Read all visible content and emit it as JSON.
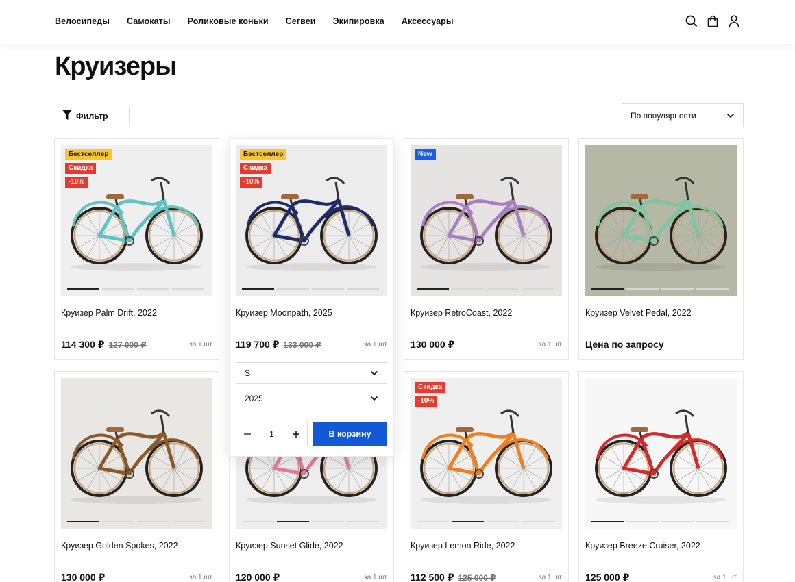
{
  "nav": [
    "Велосипеды",
    "Самокаты",
    "Роликовые коньки",
    "Сегвеи",
    "Экипировка",
    "Аксессуары"
  ],
  "page_title": "Круизеры",
  "toolbar": {
    "filter_label": "Фильтр",
    "sort_value": "По популярности"
  },
  "colors": {
    "accent": "#1358d6",
    "bestseller": "#f7c630",
    "sale": "#e9392f",
    "new": "#1a5fe0"
  },
  "products": [
    {
      "name": "Круизер Palm Drift, 2022",
      "price": "114 300 ₽",
      "old_price": "127 000 ₽",
      "per": "за 1 шт",
      "badges": [
        "Бестселлер",
        "Скидка",
        "-10%"
      ],
      "frame_color": "#5fc4c0"
    },
    {
      "name": "Круизер Moonpath, 2025",
      "price": "119 700 ₽",
      "old_price": "133 000 ₽",
      "per": "за 1 шт",
      "badges": [
        "Бестселлер",
        "Скидка",
        "-10%"
      ],
      "frame_color": "#1f2c6b"
    },
    {
      "name": "Круизер RetroCoast, 2022",
      "price": "130 000 ₽",
      "old_price": "",
      "per": "за 1 шт",
      "badges": [
        "New"
      ],
      "frame_color": "#a77fc2"
    },
    {
      "name": "Круизер Velvet Pedal, 2022",
      "price": "Цена по запросу",
      "old_price": "",
      "per": "",
      "badges": [],
      "frame_color": "#7cc6a4"
    },
    {
      "name": "Круизер Golden Spokes, 2022",
      "price": "130 000 ₽",
      "old_price": "",
      "per": "за 1 шт",
      "badges": [],
      "frame_color": "#8a5a2b"
    },
    {
      "name": "Круизер Sunset Glide, 2022",
      "price": "120 000 ₽",
      "old_price": "",
      "per": "за 1 шт",
      "badges": [],
      "frame_color": "#e9779c"
    },
    {
      "name": "Круизер Lemon Ride, 2022",
      "price": "112 500 ₽",
      "old_price": "125 000 ₽",
      "per": "за 1 шт",
      "badges": [
        "Скидка",
        "-10%"
      ],
      "frame_color": "#f07f1e"
    },
    {
      "name": "Круизер Breeze Cruiser, 2022",
      "price": "125 000 ₽",
      "old_price": "",
      "per": "за 1 шт",
      "badges": [],
      "frame_color": "#d52a2a"
    }
  ],
  "hover_panel": {
    "size_value": "S",
    "year_value": "2025",
    "quantity": "1",
    "add_to_cart": "В корзину"
  }
}
